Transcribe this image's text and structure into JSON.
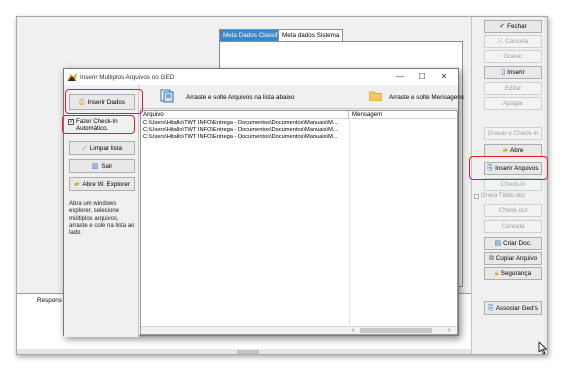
{
  "background_window": {
    "tabs": [
      {
        "label": "Meta Dados Classif.",
        "active": true
      },
      {
        "label": "Meta dados Sistema",
        "active": false
      }
    ],
    "bottom_label": "Respons"
  },
  "right_toolbar": {
    "fechar": "Fechar",
    "cancela": "Cancela",
    "gravar": "Gravar",
    "inserir": "Inserir",
    "editar": "Editar",
    "apagar": "Apagar",
    "gravar_checkin": "Gravar e Check-in",
    "abre": "Abre",
    "inserir_arquivos": "Inserir Arquivos",
    "checkin": "Check-in",
    "grava_titulo_doc": "Grava Título doc",
    "checkout": "Check-out",
    "cancela2": "Cancela",
    "criar_doc": "Criar Doc.",
    "copiar_arquivo": "Copiar Arquivo",
    "seguranca": "Segurança",
    "associar_geds": "Associar Ged's"
  },
  "dialog": {
    "title": "Inserir Multiplos Arquivos no GED",
    "controls": {
      "minimize": "—",
      "maximize": "☐",
      "close": "✕"
    },
    "sidebar": {
      "inserir_dados": "Inserir Dados",
      "checkin_label": "Fazer Check-In Automático.",
      "checkin_checked": true,
      "limpar_lista": "Limpar lista",
      "sair": "Sair",
      "abre_explorer": "Abre W. Explorer",
      "help_text": "Abra um windows explorer, selecione múltiplos arquivos, arraste e cole na lista ao lado."
    },
    "drop_left_label": "Arraste e solte Arquivos na lista abaixo",
    "drop_right_label": "Arraste e solte Mensagens",
    "columns": [
      "Arquivo",
      "Mensagem"
    ],
    "rows": [
      "C:\\Users\\Hitallo\\TWT INFO\\Entrega - Documentos\\Documentos\\Manuais\\M...",
      "C:\\Users\\Hitallo\\TWT INFO\\Entrega - Documentos\\Documentos\\Manuais\\M...",
      "C:\\Users\\Hitallo\\TWT INFO\\Entrega - Documentos\\Documentos\\Manuais\\M..."
    ]
  },
  "icons": {
    "checkmark": "checkmark-icon",
    "folder": "folder-icon",
    "exit": "exit-door-icon",
    "broom": "broom-icon"
  },
  "colors": {
    "highlight_red": "#d9212c",
    "active_tab_blue": "#3f86c7",
    "fechar_check_green": "#2e9a2e"
  }
}
